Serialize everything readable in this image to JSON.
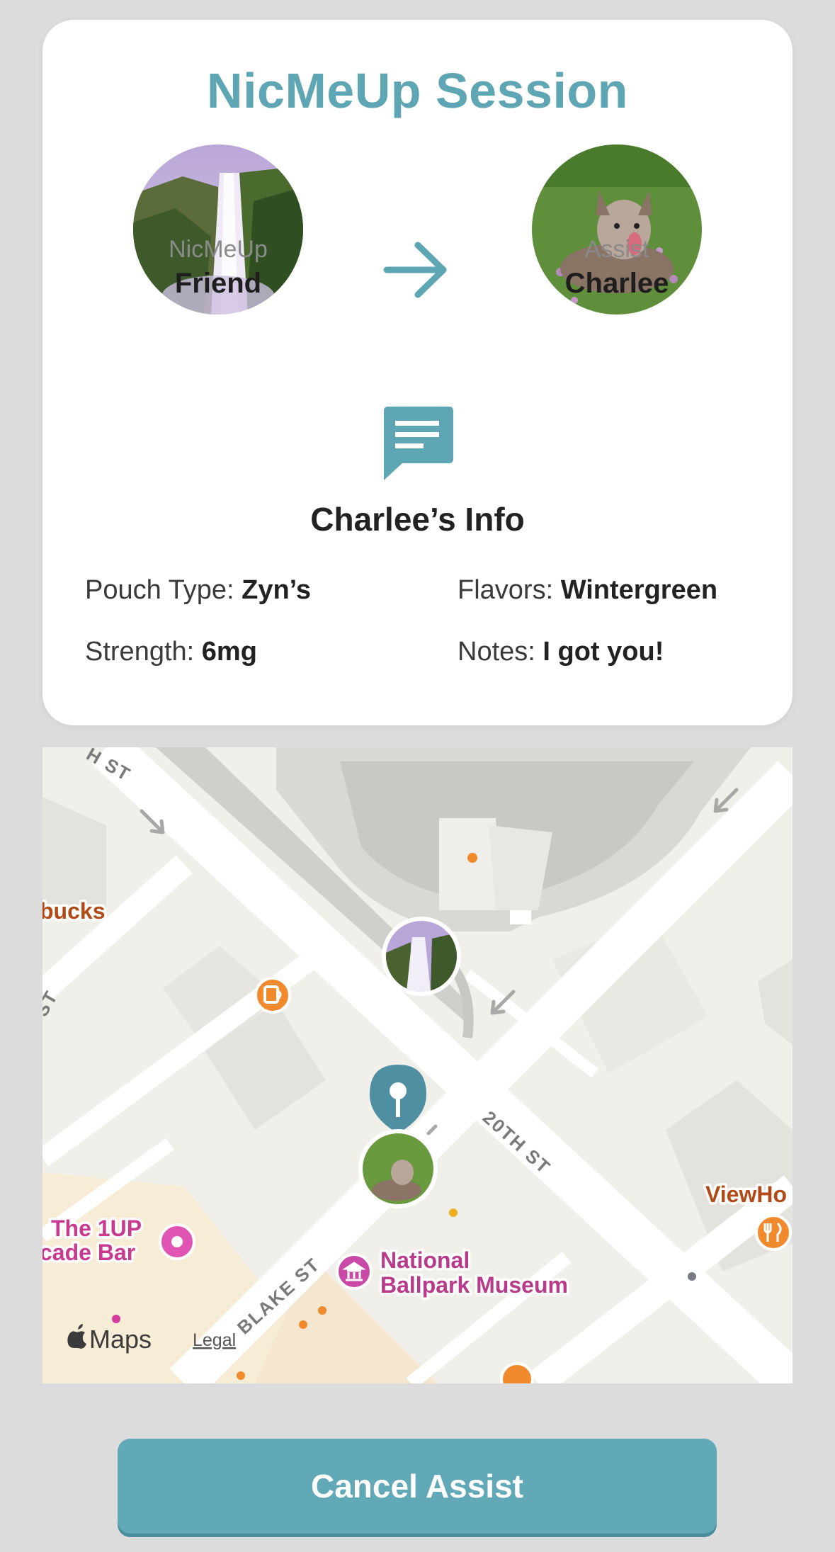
{
  "session": {
    "title": "NicMeUp Session",
    "from": {
      "role": "NicMeUp",
      "name": "Friend"
    },
    "to": {
      "role": "Assist",
      "name": "Charlee"
    },
    "info_title": "Charlee’s Info",
    "fields": {
      "pouch_label": "Pouch Type: ",
      "pouch_value": "Zyn’s",
      "flavors_label": "Flavors: ",
      "flavors_value": "Wintergreen",
      "strength_label": "Strength: ",
      "strength_value": "6mg",
      "notes_label": "Notes: ",
      "notes_value": "I got you!"
    }
  },
  "map": {
    "labels": {
      "starbucks": "bucks",
      "bar_line1": "The 1UP",
      "bar_line2": "cade Bar",
      "museum_line1": "National",
      "museum_line2": "Ballpark Museum",
      "viewhouse": "ViewHo",
      "street_20th": "20TH ST",
      "street_blake": "BLAKE ST",
      "street_top": "H ST",
      "street_left": "ST"
    },
    "attribution": "Maps",
    "legal": "Legal"
  },
  "actions": {
    "cancel_label": "Cancel Assist"
  },
  "colors": {
    "accent": "#5fa6b4",
    "button": "#62a9b8"
  }
}
